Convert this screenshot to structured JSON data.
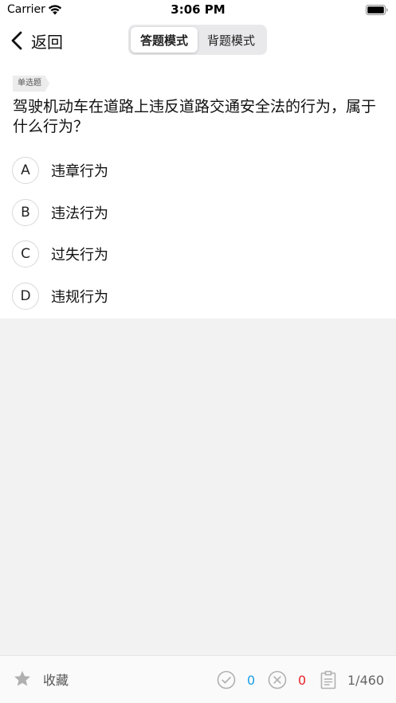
{
  "status_bar": {
    "carrier": "Carrier",
    "time": "3:06 PM",
    "wifi_icon": "wifi-icon",
    "battery_icon": "battery-icon"
  },
  "nav": {
    "back_label": "返回",
    "back_icon": "chevron-left-icon",
    "modes": [
      {
        "label": "答题模式",
        "active": true
      },
      {
        "label": "背题模式",
        "active": false
      }
    ]
  },
  "question": {
    "type_tag": "单选题",
    "text": "驾驶机动车在道路上违反道路交通安全法的行为，属于什么行为？",
    "options": [
      {
        "letter": "A",
        "text": "违章行为"
      },
      {
        "letter": "B",
        "text": "违法行为"
      },
      {
        "letter": "C",
        "text": "过失行为"
      },
      {
        "letter": "D",
        "text": "违规行为"
      }
    ]
  },
  "bottom_bar": {
    "favorite_label": "收藏",
    "favorite_icon": "star-icon",
    "correct_icon": "check-circle-icon",
    "correct_count": "0",
    "wrong_icon": "x-circle-icon",
    "wrong_count": "0",
    "progress_icon": "clipboard-icon",
    "progress": "1/460"
  },
  "colors": {
    "correct": "#1a9be8",
    "wrong": "#e8242a",
    "icon_gray": "#b0b0b0"
  }
}
